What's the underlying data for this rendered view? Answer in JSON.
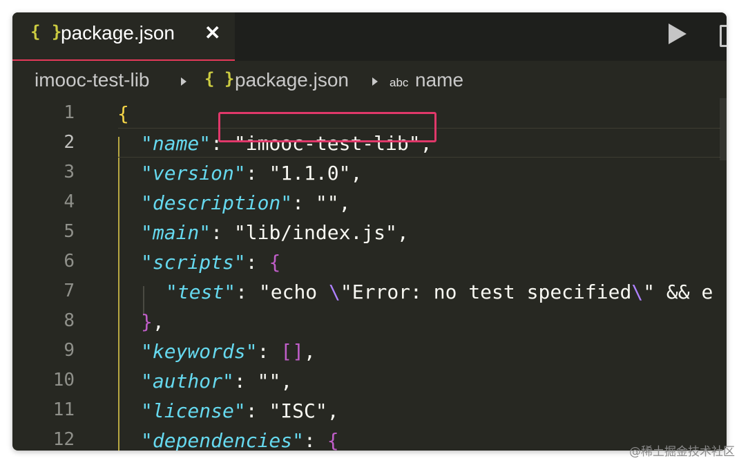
{
  "tab": {
    "icon": "json-braces-icon",
    "braces": "{ }",
    "label": "package.json",
    "close": "✕"
  },
  "breadcrumb": {
    "folder": "imooc-test-lib",
    "file_braces": "{ }",
    "file": "package.json",
    "symbol_type": "abc",
    "symbol": "name"
  },
  "editor": {
    "active_line": 2,
    "line_numbers": [
      "1",
      "2",
      "3",
      "4",
      "5",
      "6",
      "7",
      "8",
      "9",
      "10",
      "11",
      "12"
    ]
  },
  "code": {
    "l1": "{",
    "l2_key": "name",
    "l2_val": "\"imooc-test-lib\"",
    "l3_key": "version",
    "l3_val": "\"1.1.0\"",
    "l4_key": "description",
    "l4_val": "\"\"",
    "l5_key": "main",
    "l5_val": "\"lib/index.js\"",
    "l6_key": "scripts",
    "l6_open": "{",
    "l7_key": "test",
    "l7_val_a": "\"echo ",
    "l7_esc1": "\\",
    "l7_val_b": "\"Error: no test specified",
    "l7_esc2": "\\",
    "l7_val_c": "\" && e",
    "l8_close": "}",
    "l9_key": "keywords",
    "l9_val": "[]",
    "l10_key": "author",
    "l10_val": "\"\"",
    "l11_key": "license",
    "l11_val": "\"ISC\"",
    "l12_key": "dependencies",
    "l12_open": "{"
  },
  "watermark": "@稀土掘金技术社区",
  "colors": {
    "background": "#272822",
    "accent": "#e5395a",
    "key": "#66d9ef",
    "brace": "#f5d547"
  }
}
